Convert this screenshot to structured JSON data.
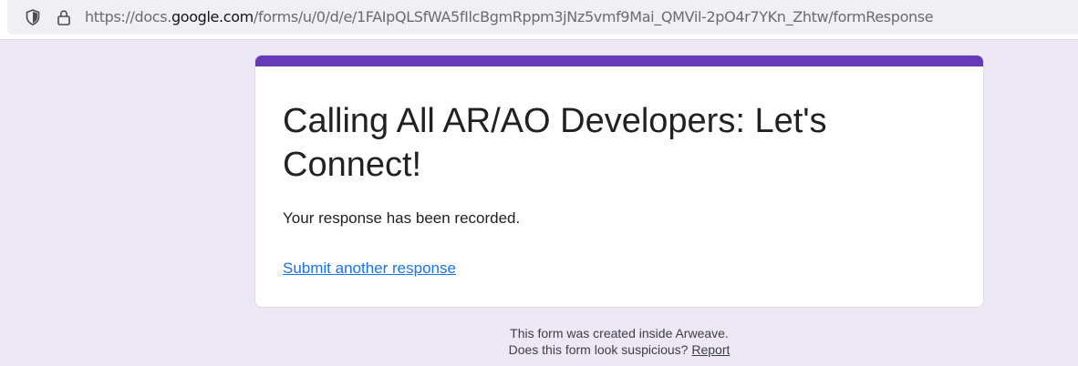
{
  "browser": {
    "url_prefix": "https://docs.",
    "url_domain": "google.com",
    "url_path": "/forms/u/0/d/e/1FAIpQLSfWA5fIlcBgmRppm3jNz5vmf9Mai_QMVil-2pO4r7YKn_Zhtw/formResponse",
    "shield_icon": "shield-icon",
    "lock_icon": "lock-icon"
  },
  "form": {
    "accent_color": "#673ab7",
    "title": "Calling All AR/AO Developers: Let's Connect!",
    "confirmation": "Your response has been recorded.",
    "submit_another": "Submit another response"
  },
  "footer": {
    "line1": "This form was created inside Arweave.",
    "line2_text": "Does this form look suspicious?",
    "report_link": "Report"
  }
}
